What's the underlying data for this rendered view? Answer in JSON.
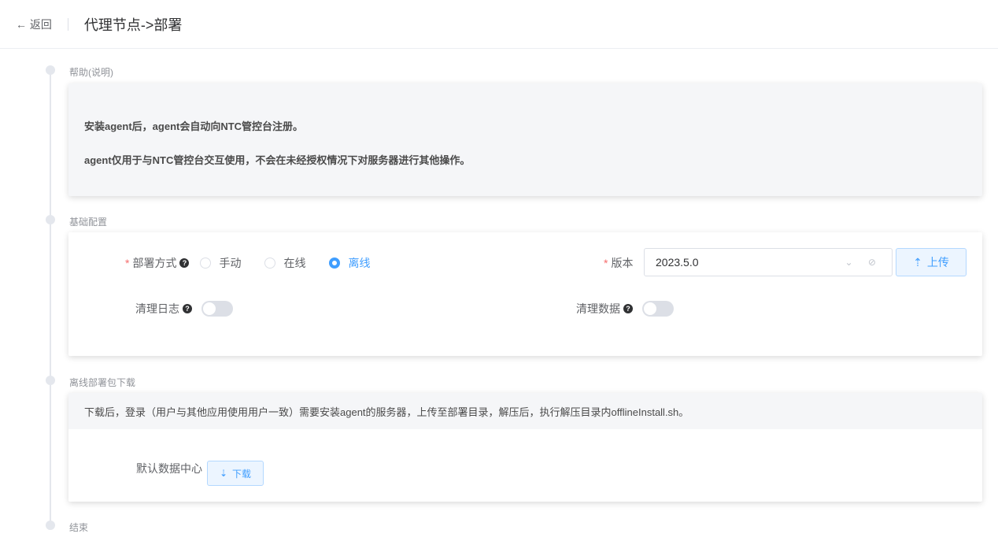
{
  "header": {
    "back": "← 返回",
    "title": "代理节点->部署"
  },
  "steps": {
    "help": "帮助(说明)",
    "basic": "基础配置",
    "download": "离线部署包下载",
    "end": "结束"
  },
  "help": {
    "line1": "安装agent后，agent会自动向NTC管控台注册。",
    "line2": "agent仅用于与NTC管控台交互使用，不会在未经授权情况下对服务器进行其他操作。"
  },
  "basic": {
    "mode_label": "部署方式",
    "modes": [
      "手动",
      "在线",
      "离线"
    ],
    "selected_mode": "离线",
    "version_label": "版本",
    "version_value": "2023.5.0",
    "upload": "上传",
    "clear_log": "清理日志",
    "clear_data": "清理数据"
  },
  "download": {
    "tip": "下载后，登录（用户与其他应用使用用户一致）需要安装agent的服务器，上传至部署目录，解压后，执行解压目录内offlineInstall.sh。",
    "dc_label": "默认数据中心",
    "btn": "下载"
  }
}
